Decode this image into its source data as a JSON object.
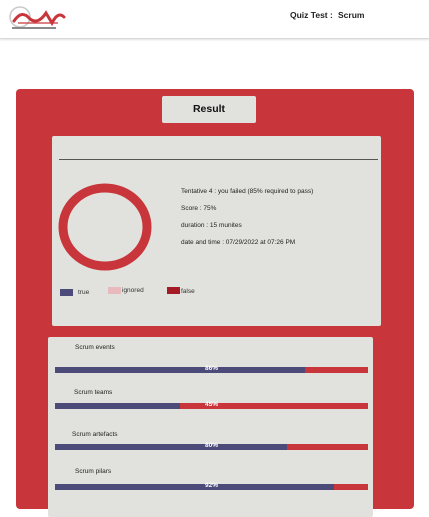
{
  "header": {
    "quiz_label": "Quiz Test :",
    "quiz_name": "Scrum"
  },
  "result": {
    "button_label": "Result",
    "attempt_text": "Tentative   4 :   you failed (85% required to pass)",
    "score_text": "Score : 75%",
    "duration_text": "duration : 15 munites",
    "date_text": "date and time : 07/29/2022 at 07:26 PM",
    "score_fraction": 0.75
  },
  "legend": [
    {
      "label": "true",
      "color": "#4b4a78"
    },
    {
      "label": "ignored",
      "color": "#e8b9bd"
    },
    {
      "label": "false",
      "color": "#a51a24"
    }
  ],
  "categories": [
    {
      "label": "Scrum events",
      "percent_text": "86%",
      "fill": 0.8
    },
    {
      "label": "Scrum teams",
      "percent_text": "45%",
      "fill": 0.4
    },
    {
      "label": "Scrum artefacts",
      "percent_text": "80%",
      "fill": 0.74
    },
    {
      "label": "Scrum pilars",
      "percent_text": "92%",
      "fill": 0.89
    }
  ],
  "colors": {
    "brand_red": "#c8363b",
    "card_bg": "#e1e2dd",
    "true_bar": "#4b4a78"
  }
}
